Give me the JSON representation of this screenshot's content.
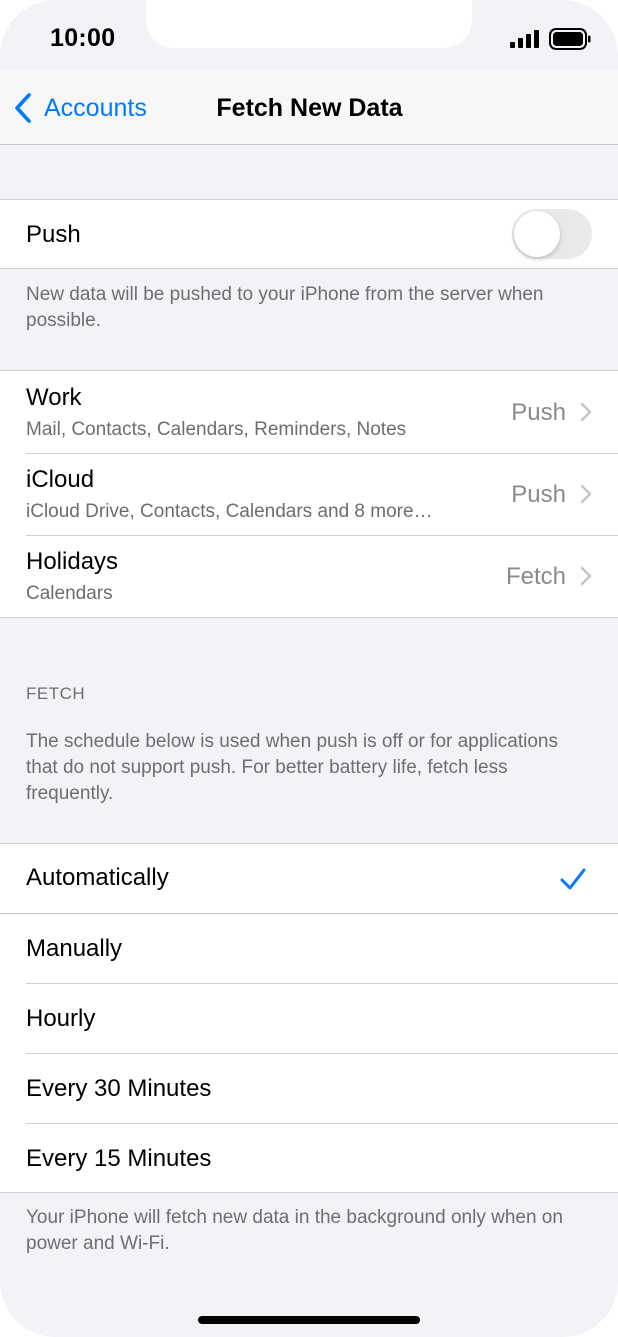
{
  "status_bar": {
    "time": "10:00"
  },
  "nav": {
    "back_label": "Accounts",
    "title": "Fetch New Data"
  },
  "push": {
    "label": "Push",
    "enabled": false,
    "footer": "New data will be pushed to your iPhone from the server when possible."
  },
  "accounts": [
    {
      "name": "Work",
      "detail": "Mail, Contacts, Calendars, Reminders, Notes",
      "value": "Push"
    },
    {
      "name": "iCloud",
      "detail": "iCloud Drive, Contacts, Calendars and 8 more…",
      "value": "Push"
    },
    {
      "name": "Holidays",
      "detail": "Calendars",
      "value": "Fetch"
    }
  ],
  "fetch": {
    "header": "FETCH",
    "description": "The schedule below is used when push is off or for applications that do not support push. For better battery life, fetch less frequently.",
    "options": [
      "Automatically",
      "Manually",
      "Hourly",
      "Every 30 Minutes",
      "Every 15 Minutes"
    ],
    "selected": "Automatically",
    "footer": "Your iPhone will fetch new data in the background only when on power and Wi-Fi."
  },
  "colors": {
    "accent": "#007aff",
    "background": "#f2f2f7"
  }
}
